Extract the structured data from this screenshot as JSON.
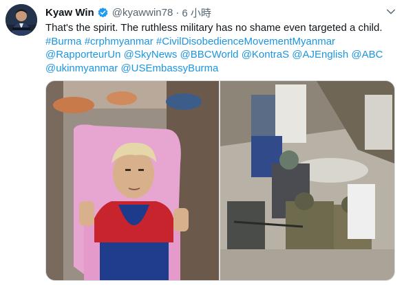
{
  "tweet": {
    "author_name": "Kyaw Win",
    "handle": "@kyawwin78",
    "separator": "·",
    "time": "6 小時",
    "text_line1": "That's the spirit. The ruthless military has no shame even targeted a child.",
    "tags": [
      "#Burma",
      "#crphmyanmar",
      "#CivilDisobedienceMovementMyanmar",
      "@RapporteurUn",
      "@SkyNews",
      "@BBCWorld",
      "@KontraS",
      "@AJEnglish",
      "@ABC",
      "@ukinmyanmar",
      "@USEmbassyBurma"
    ]
  },
  "colors": {
    "link": "#1b95e0",
    "verified": "#1d9bf0",
    "secondary_text": "#536471"
  },
  "media": {
    "left_photo": "child-in-spiderman-shirt-showing-three-finger-salute",
    "right_photo": "armed-soldiers-detaining-people-on-street"
  },
  "icons": [
    "verified-badge-icon",
    "chevron-down-icon"
  ]
}
